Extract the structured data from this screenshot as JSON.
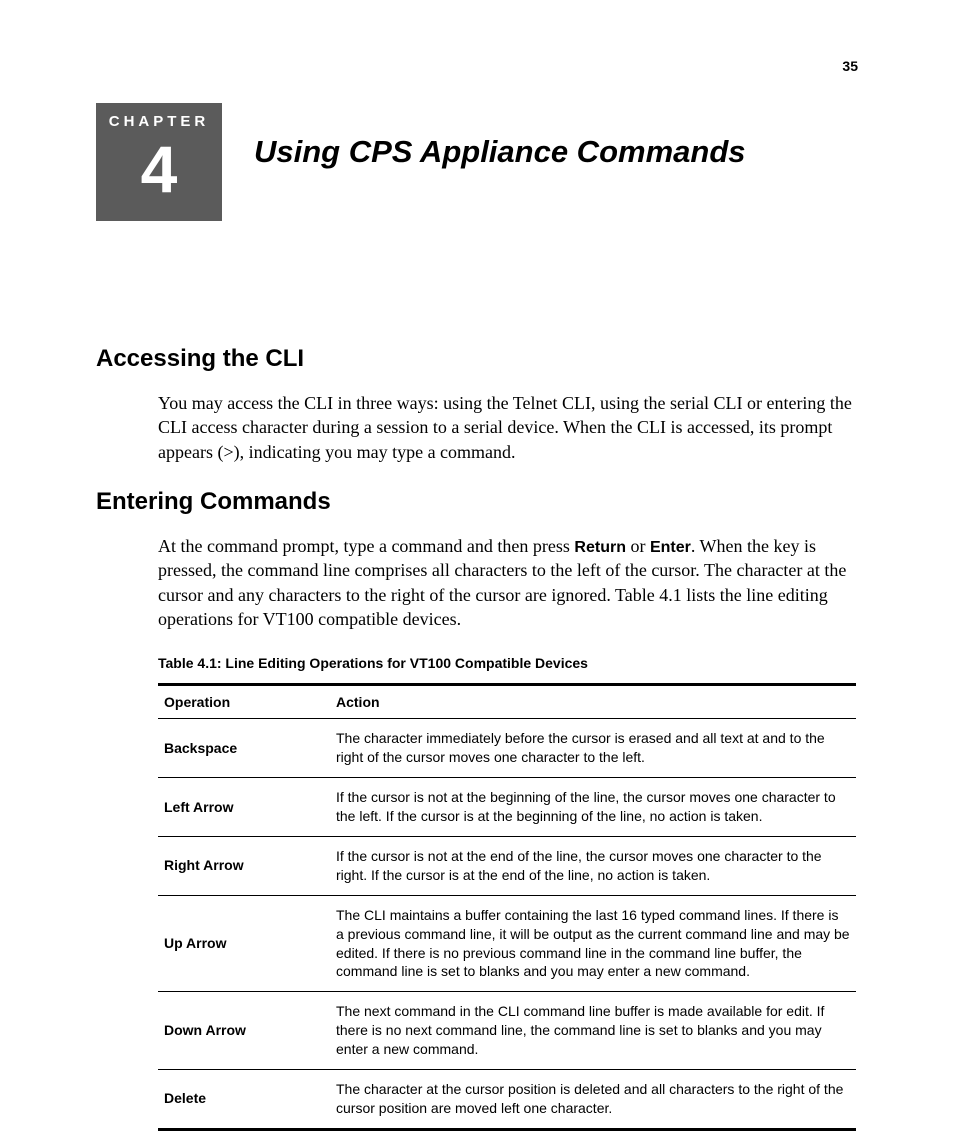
{
  "page_number": "35",
  "chapter": {
    "label": "CHAPTER",
    "number": "4",
    "title": "Using CPS Appliance Commands"
  },
  "sections": {
    "s1": {
      "heading": "Accessing the CLI",
      "para": "You may access the CLI in three ways: using the Telnet CLI, using the serial CLI or entering the CLI access character during a session to a serial device. When the CLI is accessed, its prompt appears (>), indicating you may type a command."
    },
    "s2": {
      "heading": "Entering Commands",
      "para_pre": "At the command prompt, type a command and then press ",
      "kw1": "Return",
      "mid": " or ",
      "kw2": "Enter",
      "para_post": ". When the key is pressed, the command line comprises all characters to the left of the cursor. The character at the cursor and any characters to the right of the cursor are ignored. Table 4.1 lists the line editing operations for VT100 compatible devices."
    }
  },
  "table": {
    "caption": "Table 4.1: Line Editing Operations for VT100 Compatible Devices",
    "head": {
      "op": "Operation",
      "action": "Action"
    },
    "rows": [
      {
        "op": "Backspace",
        "action": "The character immediately before the cursor is erased and all text at and to the right of the cursor moves one character to the left."
      },
      {
        "op": "Left Arrow",
        "action": "If the cursor is not at the beginning of the line, the cursor moves one character to the left. If the cursor is at the beginning of the line, no action is taken."
      },
      {
        "op": "Right Arrow",
        "action": "If the cursor is not at the end of the line, the cursor moves one character to the right. If the cursor is at the end of the line, no action is taken."
      },
      {
        "op": "Up Arrow",
        "action": "The CLI maintains a buffer containing the last 16 typed command lines. If there is a previous command line, it will be output as the current command line and may be edited. If there is no previous command line in the command line buffer, the command line is set to blanks and you may enter a new command."
      },
      {
        "op": "Down Arrow",
        "action": "The next command in the CLI command line buffer is made available for edit. If there is no next command line, the command line is set to blanks and you may enter a new command."
      },
      {
        "op": "Delete",
        "action": "The character at the cursor position is deleted and all characters to the right of the cursor position are moved left one character."
      }
    ]
  }
}
